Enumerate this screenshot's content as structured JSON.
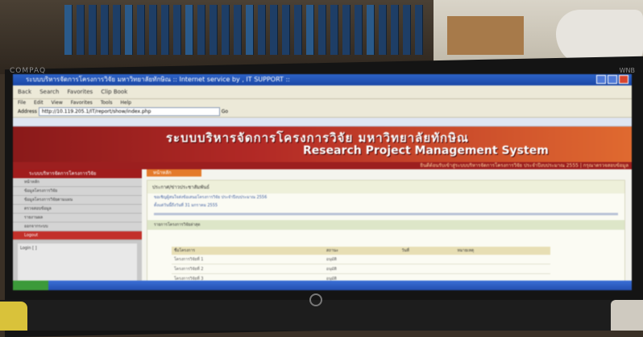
{
  "monitor": {
    "brand": "COMPAQ",
    "corner_text": "WNB"
  },
  "browser": {
    "window_title": "ระบบบริหารจัดการโครงการวิจัย มหาวิทยาลัยทักษิณ :: Internet service by , IT SUPPORT ::",
    "toolbar": [
      "Back",
      "Search",
      "Favorites",
      "Clip Book"
    ],
    "menu": [
      "File",
      "Edit",
      "View",
      "Favorites",
      "Tools",
      "Help"
    ],
    "address_label": "Address",
    "url": "http://10.119.205.1/IT/report/show/index.php",
    "go_label": "Go"
  },
  "site": {
    "title_thai": "ระบบบริหารจัดการโครงการวิจัย มหาวิทยาลัยทักษิณ",
    "title_en": "Research Project Management System",
    "marquee": "ยินดีต้อนรับเข้าสู่ระบบบริหารจัดการโครงการวิจัย ประจำปีงบประมาณ 2555 | กรุณาตรวจสอบข้อมูล"
  },
  "sidebar": {
    "heading": "ระบบบริหารจัดการโครงการวิจัย",
    "items": [
      "หน้าหลัก",
      "ข้อมูลโครงการวิจัย",
      "ข้อมูลโครงการวิจัยตามแผน",
      "ตรวจสอบข้อมูล",
      "รายงานผล",
      "ออกจากระบบ",
      "Logout"
    ],
    "box_text": "Login [ ]"
  },
  "content": {
    "breadcrumb": "หน้าหลัก",
    "panel_title": "ประกาศ/ข่าวประชาสัมพันธ์",
    "notice_1": "ขอเชิญผู้สนใจส่งข้อเสนอโครงการวิจัย ประจำปีงบประมาณ 2556",
    "notice_2": "ตั้งแต่วันนี้ถึงวันที่ 31 มกราคม 2555",
    "section": "รายการโครงการวิจัยล่าสุด",
    "table": {
      "headers": [
        "ชื่อโครงการ",
        "สถานะ",
        "วันที่",
        "หมายเหตุ"
      ],
      "rows": [
        [
          "โครงการวิจัยที่ 1",
          "อนุมัติ",
          "",
          ""
        ],
        [
          "โครงการวิจัยที่ 2",
          "อนุมัติ",
          "",
          ""
        ],
        [
          "โครงการวิจัยที่ 3",
          "อนุมัติ",
          "",
          ""
        ]
      ]
    }
  }
}
